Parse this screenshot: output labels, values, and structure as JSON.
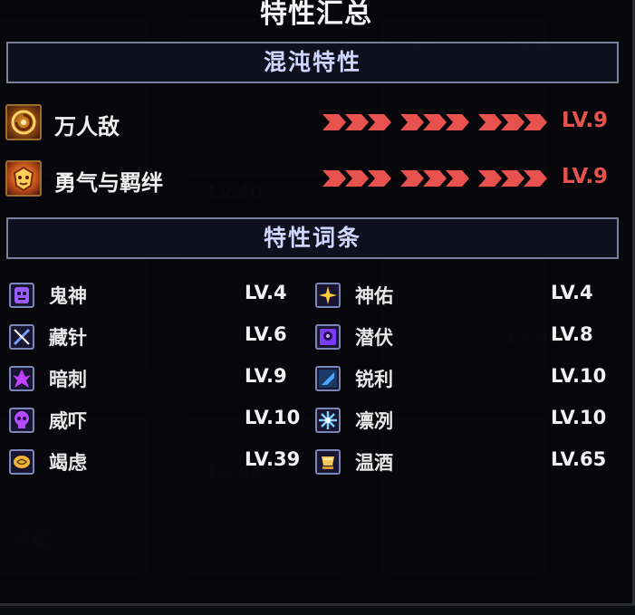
{
  "panel": {
    "title": "特性汇总"
  },
  "sections": {
    "chaos_header": "混沌特性",
    "traits_header": "特性词条"
  },
  "chaos_traits": [
    {
      "name": "万人敌",
      "level": "LV.9",
      "icon": "spiral-sun-icon"
    },
    {
      "name": "勇气与羁绊",
      "level": "LV.9",
      "icon": "lion-crest-icon"
    }
  ],
  "trait_list": [
    {
      "name": "鬼神",
      "level": "LV.4",
      "icon": "demon-god-icon",
      "color": "#9b5cff"
    },
    {
      "name": "神佑",
      "level": "LV.4",
      "icon": "divine-star-icon",
      "color": "#ffce3a"
    },
    {
      "name": "藏针",
      "level": "LV.6",
      "icon": "hidden-needle-icon",
      "color": "#6fa3ff"
    },
    {
      "name": "潜伏",
      "level": "LV.8",
      "icon": "lurk-icon",
      "color": "#7a3cff"
    },
    {
      "name": "暗刺",
      "level": "LV.9",
      "icon": "dark-thorn-icon",
      "color": "#c040ff"
    },
    {
      "name": "锐利",
      "level": "LV.10",
      "icon": "sharp-blade-icon",
      "color": "#4aa8ff"
    },
    {
      "name": "威吓",
      "level": "LV.10",
      "icon": "skull-icon",
      "color": "#b04cff"
    },
    {
      "name": "凛冽",
      "level": "LV.10",
      "icon": "frost-icon",
      "color": "#7fd0ff"
    },
    {
      "name": "竭虑",
      "level": "LV.39",
      "icon": "brain-icon",
      "color": "#f0b437"
    },
    {
      "name": "温酒",
      "level": "LV.65",
      "icon": "wine-cup-icon",
      "color": "#f2c85a"
    }
  ],
  "colors": {
    "accent_red": "#e8524e",
    "header_text": "#cfd6ff",
    "header_border": "#7a7f9c"
  },
  "background": {
    "faded_labels": [
      "Lv.40",
      "Lv.40",
      "Lv.40",
      "Lv.40",
      "Lv.40",
      "天赋"
    ]
  }
}
